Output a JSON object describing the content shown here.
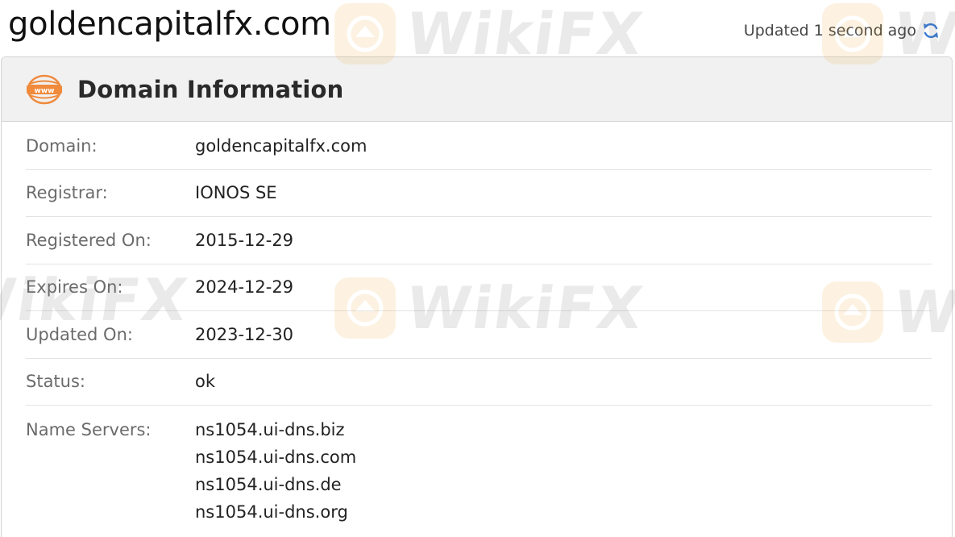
{
  "site": {
    "title": "goldencapitalfx.com",
    "updated_text": "Updated 1 second ago"
  },
  "card": {
    "title": "Domain Information",
    "header_icon_name": "www-icon",
    "rows": [
      {
        "label": "Domain:",
        "value": "goldencapitalfx.com"
      },
      {
        "label": "Registrar:",
        "value": "IONOS SE"
      },
      {
        "label": "Registered On:",
        "value": "2015-12-29"
      },
      {
        "label": "Expires On:",
        "value": "2024-12-29"
      },
      {
        "label": "Updated On:",
        "value": "2023-12-30"
      },
      {
        "label": "Status:",
        "value": "ok"
      }
    ],
    "name_servers": {
      "label": "Name Servers:",
      "values": [
        "ns1054.ui-dns.biz",
        "ns1054.ui-dns.com",
        "ns1054.ui-dns.de",
        "ns1054.ui-dns.org"
      ]
    }
  },
  "watermark": {
    "text": "WikiFX"
  },
  "colors": {
    "accent_orange": "#f08a3c",
    "refresh_blue": "#3a7bd5",
    "header_bg": "#f1f1f1",
    "label_gray": "#6b6b6b"
  }
}
